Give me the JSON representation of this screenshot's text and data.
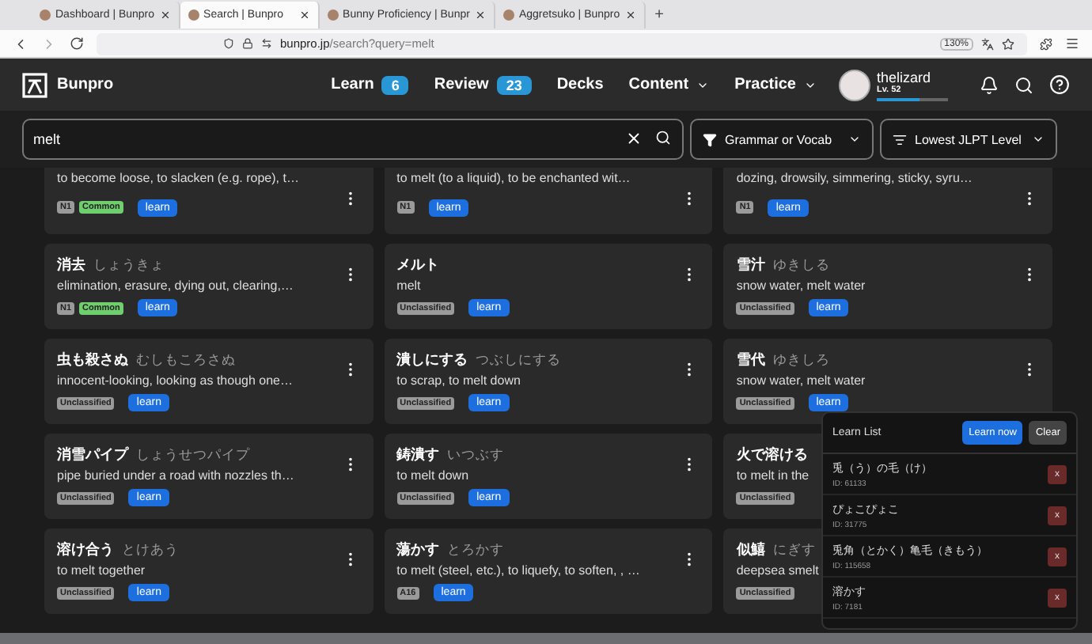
{
  "browser": {
    "tabs": [
      {
        "title": "Dashboard | Bunpro",
        "selected": false
      },
      {
        "title": "Search | Bunpro",
        "selected": true
      },
      {
        "title": "Bunny Proficiency | Bunpr",
        "selected": false
      },
      {
        "title": "Aggretsuko | Bunpro",
        "selected": false
      }
    ],
    "new_tab": "+",
    "url_host": "bunpro.jp",
    "url_path": "/search?query=melt",
    "zoom": "130%"
  },
  "nav": {
    "brand": "Bunpro",
    "links": [
      {
        "label": "Learn",
        "badge": "6",
        "kind": "badge"
      },
      {
        "label": "Review",
        "badge": "23",
        "kind": "badge"
      },
      {
        "label": "Decks",
        "kind": "plain"
      },
      {
        "label": "Content",
        "kind": "menu"
      },
      {
        "label": "Practice",
        "kind": "menu"
      }
    ],
    "user": {
      "name": "thelizard",
      "level_text": "Lv. 52",
      "level": 0.6
    }
  },
  "search": {
    "value": "melt",
    "filter": "Grammar or Vocab",
    "sort": "Lowest JLPT Level"
  },
  "results": [
    {
      "meaning": "to become loose, to slacken (e.g. rope), t…",
      "tags": [
        {
          "label": "N1",
          "kind": "level"
        },
        {
          "label": "Common",
          "kind": "common"
        }
      ],
      "button": "learn"
    },
    {
      "meaning": "to melt (to a liquid), to be enchanted wit…",
      "tags": [
        {
          "label": "N1",
          "kind": "level"
        }
      ],
      "button": "learn"
    },
    {
      "meaning": "dozing, drowsily, simmering, sticky, syru…",
      "tags": [
        {
          "label": "N1",
          "kind": "level"
        }
      ],
      "button": "learn"
    },
    {
      "word": "消去",
      "reading": "しょうきょ",
      "meaning": "elimination, erasure, dying out, clearing,…",
      "tags": [
        {
          "label": "N1",
          "kind": "level"
        },
        {
          "label": "Common",
          "kind": "common"
        }
      ],
      "button": "learn"
    },
    {
      "word": "メルト",
      "meaning": "melt",
      "tags": [
        {
          "label": "Unclassified",
          "kind": "level"
        }
      ],
      "button": "learn"
    },
    {
      "word": "雪汁",
      "reading": "ゆきしる",
      "meaning": "snow water, melt water",
      "tags": [
        {
          "label": "Unclassified",
          "kind": "level"
        }
      ],
      "button": "learn"
    },
    {
      "word": "虫も殺さぬ",
      "reading": "むしもころさぬ",
      "meaning": "innocent-looking, looking as though one…",
      "tags": [
        {
          "label": "Unclassified",
          "kind": "level"
        }
      ],
      "button": "learn"
    },
    {
      "word": "潰しにする",
      "reading": "つぶしにする",
      "meaning": "to scrap, to melt down",
      "tags": [
        {
          "label": "Unclassified",
          "kind": "level"
        }
      ],
      "button": "learn"
    },
    {
      "word": "雪代",
      "reading": "ゆきしろ",
      "meaning": "snow water, melt water",
      "tags": [
        {
          "label": "Unclassified",
          "kind": "level"
        }
      ],
      "button": "learn"
    },
    {
      "word": "消雪パイプ",
      "reading": "しょうせつパイプ",
      "meaning": "pipe buried under a road with nozzles th…",
      "tags": [
        {
          "label": "Unclassified",
          "kind": "level"
        }
      ],
      "button": "learn"
    },
    {
      "word": "鋳潰す",
      "reading": "いつぶす",
      "meaning": "to melt down",
      "tags": [
        {
          "label": "Unclassified",
          "kind": "level"
        }
      ],
      "button": "learn"
    },
    {
      "word": "火で溶ける",
      "meaning": "to melt in the",
      "tags": [
        {
          "label": "Unclassified",
          "kind": "level"
        }
      ]
    },
    {
      "word": "溶け合う",
      "reading": "とけあう",
      "meaning": "to melt together",
      "tags": [
        {
          "label": "Unclassified",
          "kind": "level"
        }
      ],
      "button": "learn"
    },
    {
      "word": "蕩かす",
      "reading": "とろかす",
      "meaning": "to melt (steel, etc.), to liquefy, to soften, , …",
      "tags": [
        {
          "label": "A16",
          "kind": "level"
        }
      ],
      "button": "learn"
    },
    {
      "word": "似鱚",
      "reading": "にぎす",
      "meaning": "deepsea smelt",
      "tags": [
        {
          "label": "Unclassified",
          "kind": "level"
        }
      ]
    }
  ],
  "learn_list": {
    "title": "Learn List",
    "learn_now": "Learn now",
    "clear": "Clear",
    "items": [
      {
        "name": "兎（う）の毛（け）",
        "id": "ID: 61133",
        "remove": "x"
      },
      {
        "name": "ぴょこぴょこ",
        "id": "ID: 31775",
        "remove": "x"
      },
      {
        "name": "兎角（とかく）亀毛（きもう）",
        "id": "ID: 115658",
        "remove": "x"
      },
      {
        "name": "溶かす",
        "id": "ID: 7181",
        "remove": "x"
      }
    ]
  }
}
